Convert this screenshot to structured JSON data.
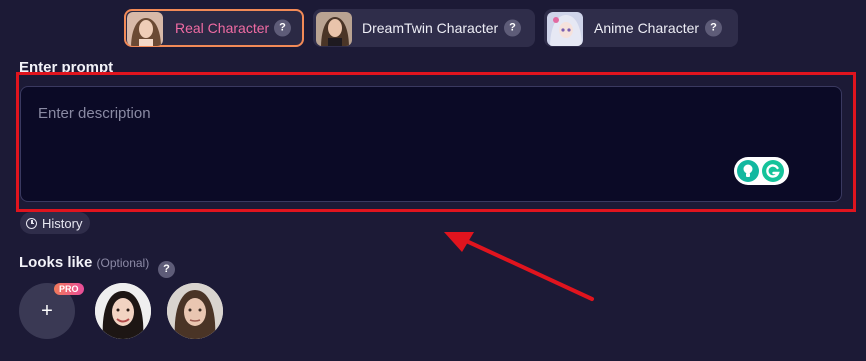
{
  "tabs": [
    {
      "label": "Real Character",
      "help": "?",
      "active": true
    },
    {
      "label": "DreamTwin Character",
      "help": "?",
      "active": false
    },
    {
      "label": "Anime Character",
      "help": "?",
      "active": false
    }
  ],
  "prompt": {
    "title": "Enter prompt",
    "placeholder": "Enter description"
  },
  "history": {
    "label": "History"
  },
  "looks_like": {
    "title": "Looks like",
    "optional": "(Optional)",
    "help": "?",
    "add_label": "+",
    "pro_badge": "PRO"
  },
  "colors": {
    "background": "#1c1a36",
    "active_border": "#f28a57",
    "active_text": "#f06ba3",
    "highlight": "#e0141e",
    "extension": "#15c39a"
  }
}
